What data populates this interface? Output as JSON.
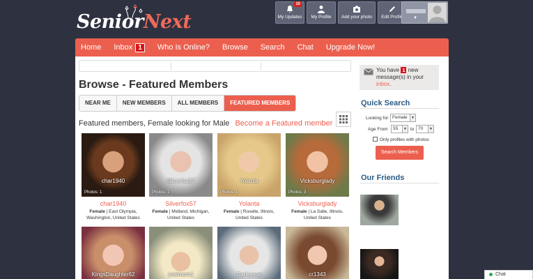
{
  "brand": {
    "logo_senior": "Senior",
    "logo_next": "Next"
  },
  "topnav": {
    "updates": {
      "label": "My Updates",
      "badge": "10"
    },
    "profile": {
      "label": "My Profile"
    },
    "photo": {
      "label": "Add your photo"
    },
    "edit": {
      "label": "Edit Profile"
    },
    "user_caret": "▼"
  },
  "mainnav": {
    "home": "Home",
    "inbox": "Inbox",
    "inbox_count": "1",
    "online": "Who Is Online?",
    "browse": "Browse",
    "search": "Search",
    "chat": "Chat",
    "upgrade": "Upgrade Now!"
  },
  "page": {
    "title": "Browse - Featured Members",
    "tabs": [
      "NEAR ME",
      "NEW MEMBERS",
      "ALL MEMBERS",
      "FEATURED MEMBERS"
    ],
    "active_tab": 3,
    "featured_text": "Featured members, Female looking for Male",
    "become_link": "Become a Featured member"
  },
  "members": [
    {
      "name": "char1940",
      "photos": "Photos: 1",
      "gender": "Female",
      "location": "East Olympia, Washington, United States"
    },
    {
      "name": "Silverfox57",
      "photos": "Photos: 1",
      "gender": "Female",
      "location": "Midland, Michigan, United States"
    },
    {
      "name": "Yolanta",
      "photos": "Photos: 1",
      "gender": "Female",
      "location": "Roselle, Illinois, United States"
    },
    {
      "name": "Vicksburglady",
      "photos": "Photos: 3",
      "gender": "Female",
      "location": "La Salle, Illinois, United States"
    },
    {
      "name": "KingsDaughter62",
      "photos": "",
      "gender": "",
      "location": ""
    },
    {
      "name": "soalmom1",
      "photos": "",
      "gender": "",
      "location": ""
    },
    {
      "name": "Carleysue",
      "photos": "",
      "gender": "",
      "location": ""
    },
    {
      "name": "cr1343",
      "photos": "",
      "gender": "",
      "location": ""
    }
  ],
  "sidebar": {
    "msg_prefix": "You have",
    "msg_count": "1",
    "msg_suffix": "new message(s) in your",
    "msg_link": "inbox",
    "msg_end": ".",
    "qs_title": "Quick Search",
    "looking_for_label": "Looking for:",
    "looking_for_value": "Female",
    "age_from_label": "Age From",
    "age_from_value": "55",
    "age_to_label": "to",
    "age_to_value": "70",
    "only_photos_label": "Only profiles with photos",
    "search_button": "Search Members",
    "friends_title": "Our Friends"
  },
  "chat": {
    "label": "Chat"
  },
  "colors": {
    "accent": "#ec5f4e",
    "header_bg": "#2e3140",
    "link_blue": "#2d5b86"
  }
}
